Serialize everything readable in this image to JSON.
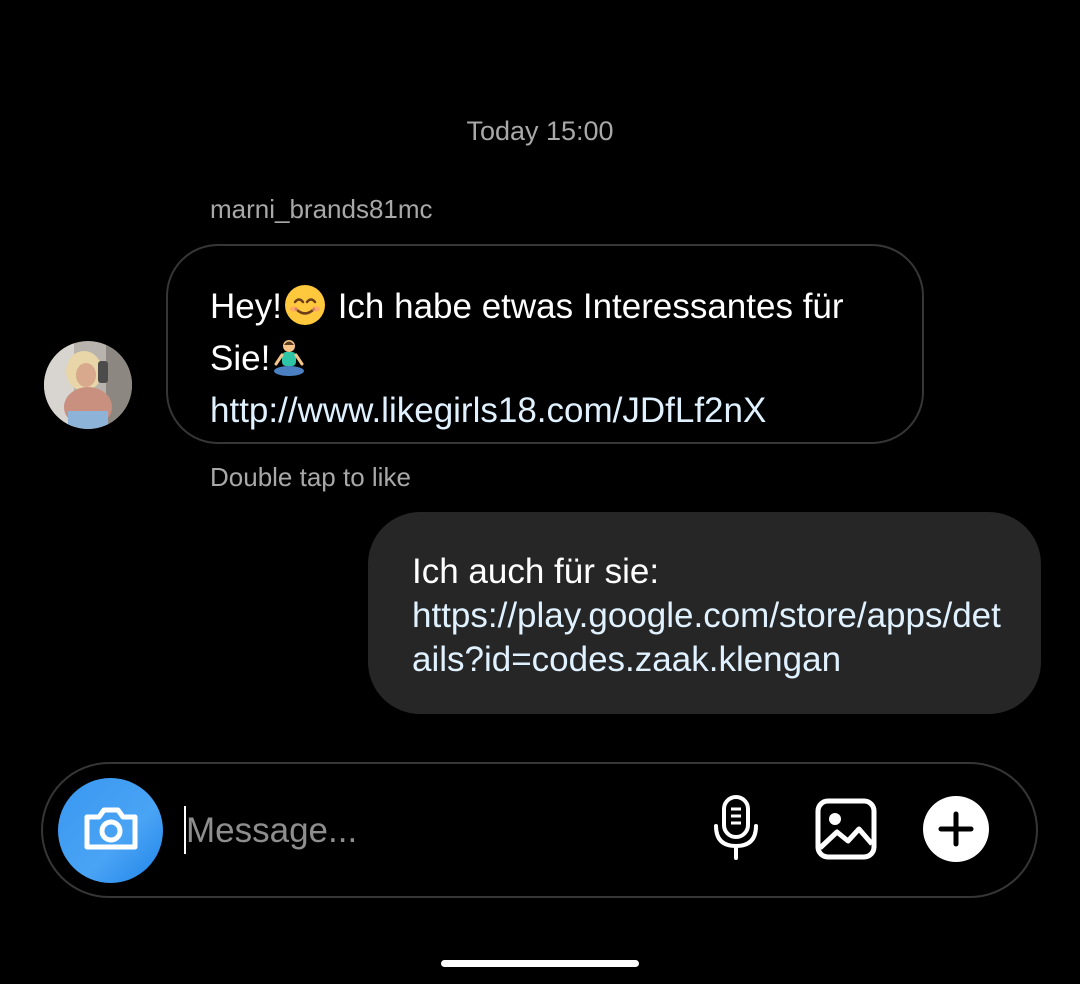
{
  "thread": {
    "timestamp": "Today 15:00",
    "incoming": {
      "sender": "marni_brands81mc",
      "avatar_icon": "profile-photo-avatar",
      "text_part1": "Hey!",
      "emoji1": "smiling-face-emoji",
      "text_part2": " Ich habe etwas Interessantes für Sie!",
      "emoji2": "person-in-lotus-position-emoji",
      "link": "http://www.likegirls18.com/JDfLf2nX"
    },
    "hint": "Double tap to like",
    "outgoing": {
      "text": "Ich auch für sie:",
      "link": "https://play.google.com/store/apps/details?id=codes.zaak.klengan"
    }
  },
  "composer": {
    "placeholder": "Message...",
    "camera_icon": "camera-icon",
    "mic_icon": "microphone-icon",
    "gallery_icon": "image-gallery-icon",
    "add_icon": "plus-circle-icon"
  },
  "colors": {
    "background": "#000000",
    "meta_text": "#a8a8a8",
    "link": "#e0f1ff",
    "outgoing_bubble": "#262626",
    "border": "#363636",
    "camera_button": "#3897f0"
  }
}
